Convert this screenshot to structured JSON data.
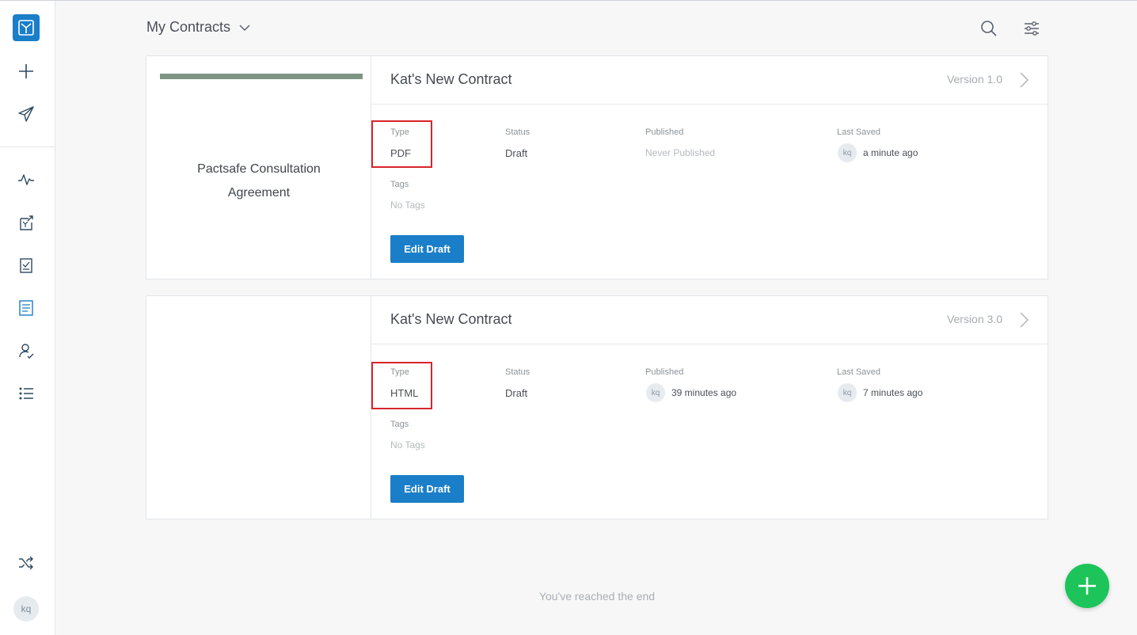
{
  "header": {
    "title": "My Contracts",
    "search_icon": "search-icon",
    "filter_icon": "sliders-icon"
  },
  "sidebar": {
    "items": [
      {
        "icon": "logo-icon"
      },
      {
        "icon": "plus-icon"
      },
      {
        "icon": "paper-plane-icon"
      },
      {
        "icon": "activity-icon"
      },
      {
        "icon": "contract-export-icon"
      },
      {
        "icon": "checklist-icon"
      },
      {
        "icon": "document-icon"
      },
      {
        "icon": "user-check-icon"
      },
      {
        "icon": "list-icon"
      },
      {
        "icon": "shuffle-icon"
      }
    ],
    "avatar": "kq"
  },
  "contracts": [
    {
      "thumbnail_title": "Pactsafe Consultation Agreement",
      "title": "Kat's New Contract",
      "version": "Version 1.0",
      "type_label": "Type",
      "type_value": "PDF",
      "status_label": "Status",
      "status_value": "Draft",
      "published_label": "Published",
      "published_value": "Never Published",
      "last_saved_label": "Last Saved",
      "last_saved_avatar": "kq",
      "last_saved_value": "a minute ago",
      "tags_label": "Tags",
      "tags_value": "No Tags",
      "button_label": "Edit Draft"
    },
    {
      "thumbnail_title": "",
      "title": "Kat's New Contract",
      "version": "Version 3.0",
      "type_label": "Type",
      "type_value": "HTML",
      "status_label": "Status",
      "status_value": "Draft",
      "published_label": "Published",
      "published_avatar": "kq",
      "published_value": "39 minutes ago",
      "last_saved_label": "Last Saved",
      "last_saved_avatar": "kq",
      "last_saved_value": "7 minutes ago",
      "tags_label": "Tags",
      "tags_value": "No Tags",
      "button_label": "Edit Draft"
    }
  ],
  "footer": {
    "end_text": "You've reached the end"
  },
  "colors": {
    "primary": "#1a7ec8",
    "fab": "#1dc45a",
    "highlight": "#d8242b",
    "thumbnail_bar": "#7d9684"
  }
}
